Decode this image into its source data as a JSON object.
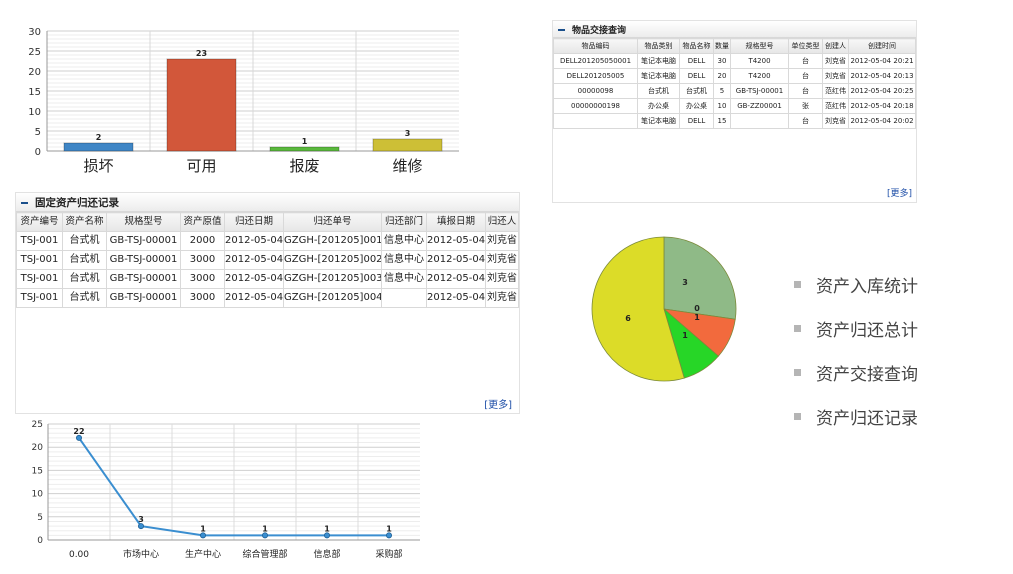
{
  "bar_chart": {
    "chart_data": {
      "type": "bar",
      "categories": [
        "损坏",
        "可用",
        "报废",
        "维修"
      ],
      "values": [
        2,
        23,
        1,
        3
      ],
      "ylim": [
        0,
        30
      ],
      "yticks": [
        "0",
        "5",
        "10",
        "15",
        "20",
        "25",
        "30"
      ],
      "grid": true,
      "colors": [
        "#3f86c6",
        "#d2573a",
        "#59b93c",
        "#cdbf36"
      ]
    }
  },
  "goods_panel": {
    "title": "物品交接查询",
    "columns": [
      "物品编码",
      "物品类别",
      "物品名称",
      "数量",
      "规格型号",
      "单位类型",
      "创建人",
      "创建时间"
    ],
    "rows": [
      [
        "DELL201205050001",
        "笔记本电脑",
        "DELL",
        "30",
        "T4200",
        "台",
        "刘克省",
        "2012-05-04 20:21"
      ],
      [
        "DELL201205005",
        "笔记本电脑",
        "DELL",
        "20",
        "T4200",
        "台",
        "刘克省",
        "2012-05-04 20:13"
      ],
      [
        "00000098",
        "台式机",
        "台式机",
        "5",
        "GB-TSJ-00001",
        "台",
        "范红伟",
        "2012-05-04 20:25"
      ],
      [
        "00000000198",
        "办公桌",
        "办公桌",
        "10",
        "GB-ZZ00001",
        "张",
        "范红伟",
        "2012-05-04 20:18"
      ],
      [
        "",
        "笔记本电脑",
        "DELL",
        "15",
        "",
        "台",
        "刘克省",
        "2012-05-04 20:02"
      ]
    ],
    "more": "[更多]"
  },
  "return_panel": {
    "title": "固定资产归还记录",
    "columns": [
      "资产编号",
      "资产名称",
      "规格型号",
      "资产原值",
      "归还日期",
      "归还单号",
      "归还部门",
      "填报日期",
      "归还人"
    ],
    "rows": [
      [
        "TSJ-001",
        "台式机",
        "GB-TSJ-00001",
        "2000",
        "2012-05-04",
        "GZGH-[201205]001",
        "信息中心",
        "2012-05-04",
        "刘克省"
      ],
      [
        "TSJ-001",
        "台式机",
        "GB-TSJ-00001",
        "3000",
        "2012-05-04",
        "GZGH-[201205]002",
        "信息中心",
        "2012-05-04",
        "刘克省"
      ],
      [
        "TSJ-001",
        "台式机",
        "GB-TSJ-00001",
        "3000",
        "2012-05-04",
        "GZGH-[201205]003",
        "信息中心",
        "2012-05-04",
        "刘克省"
      ],
      [
        "TSJ-001",
        "台式机",
        "GB-TSJ-00001",
        "3000",
        "2012-05-04",
        "GZGH-[201205]004",
        "",
        "2012-05-04",
        "刘克省"
      ]
    ],
    "more": "[更多]"
  },
  "pie_chart": {
    "chart_data": {
      "type": "pie",
      "slices": [
        {
          "value": 3,
          "label": "3",
          "color": "#8fba87"
        },
        {
          "value": 0,
          "label": "0",
          "color": "#d6a23a"
        },
        {
          "value": 1,
          "label": "1",
          "color": "#f26a3d"
        },
        {
          "value": 1,
          "label": "1",
          "color": "#27d627"
        },
        {
          "value": 6,
          "label": "6",
          "color": "#dcdc28"
        }
      ]
    }
  },
  "line_chart": {
    "chart_data": {
      "type": "line",
      "categories": [
        "0.00",
        "市场中心",
        "生产中心",
        "综合管理部",
        "信息部",
        "采购部"
      ],
      "values": [
        22,
        3,
        1,
        1,
        1,
        1
      ],
      "ylim": [
        0,
        25
      ],
      "yticks": [
        "0",
        "5",
        "10",
        "15",
        "20",
        "25"
      ],
      "grid": true,
      "color": "#3a8ed0"
    }
  },
  "menu": {
    "items": [
      "资产入库统计",
      "资产归还总计",
      "资产交接查询",
      "资产归还记录"
    ]
  }
}
